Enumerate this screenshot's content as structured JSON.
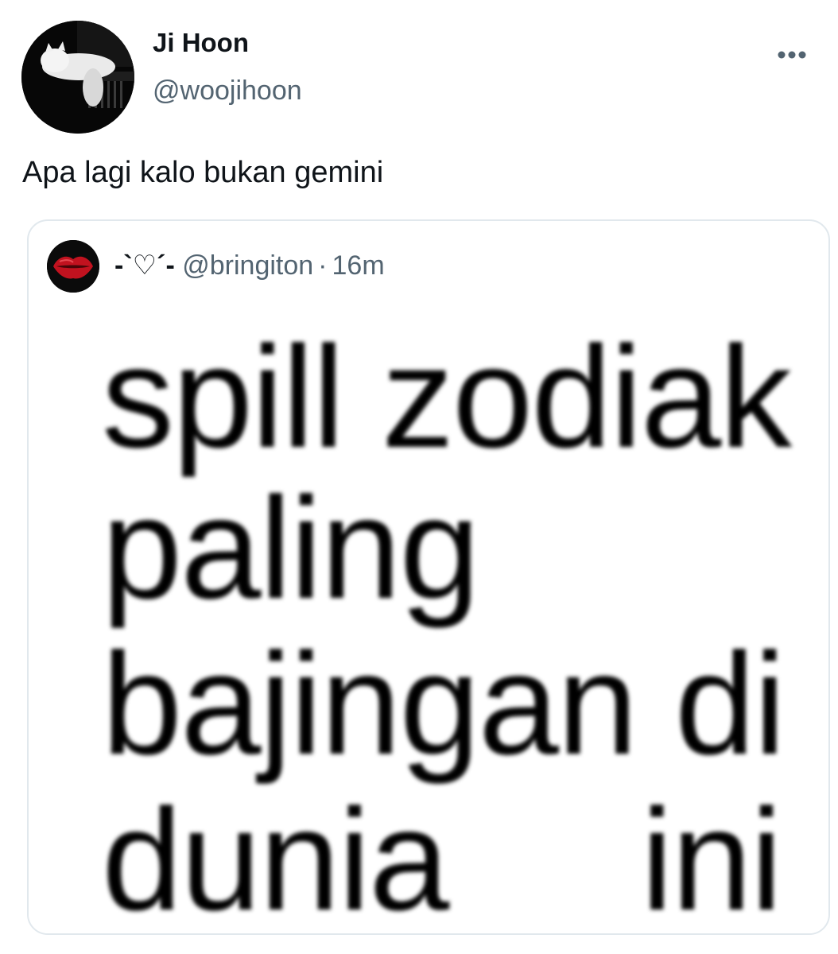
{
  "tweet": {
    "author": {
      "display_name": "Ji Hoon",
      "handle": "@woojihoon",
      "avatar_icon": "white-cat-on-piano-avatar"
    },
    "more_icon": "more-dots-icon",
    "text": "Apa lagi kalo bukan gemini"
  },
  "quoted_tweet": {
    "display_name": "-`♡´-",
    "handle": "@bringiton",
    "separator": "·",
    "time": "16m",
    "avatar_icon": "red-lips-avatar",
    "image_text_lines": [
      "spill zodiak",
      "paling",
      "bajingan di",
      "dunia     ini"
    ]
  },
  "colors": {
    "text_primary": "#0f1419",
    "text_secondary": "#536471",
    "border": "#e1e8ed",
    "background": "#ffffff"
  }
}
